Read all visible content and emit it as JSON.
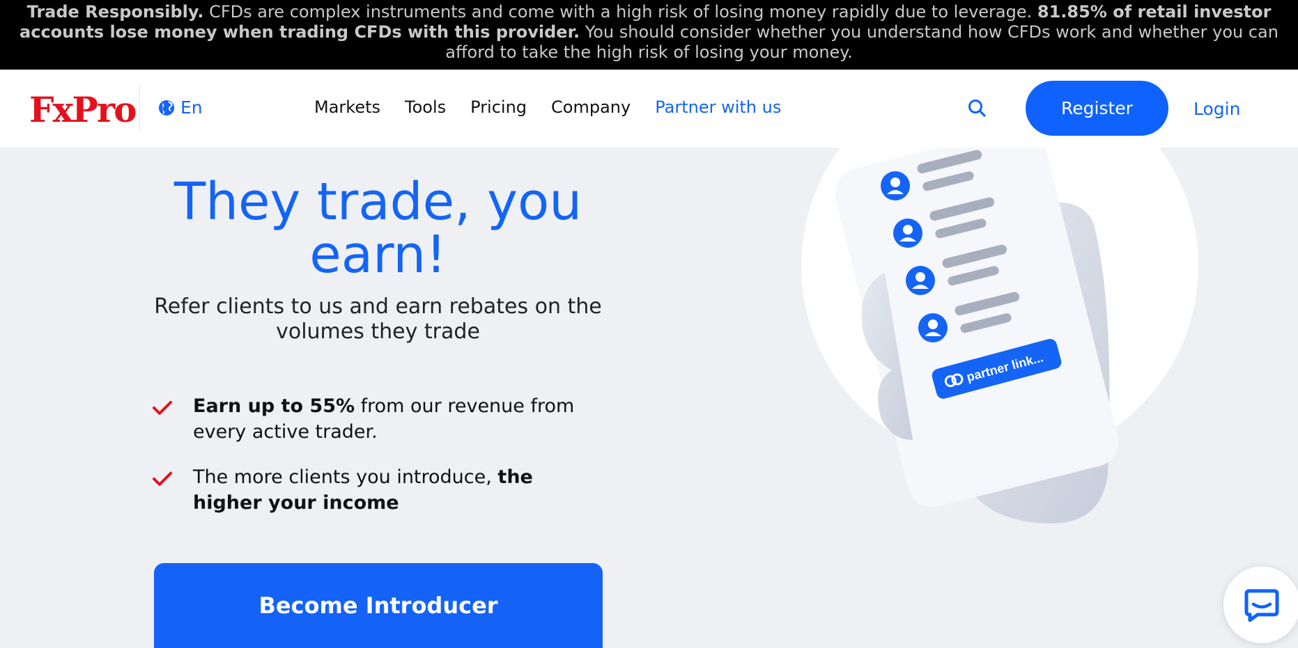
{
  "risk_warning": {
    "lead": "Trade Responsibly.",
    "text1": " CFDs are complex instruments and come with a high risk of losing money rapidly due to leverage. ",
    "stat": "81.85% of retail investor accounts lose money when trading CFDs with this provider.",
    "text2": " You should consider whether you understand how CFDs work and whether you can afford to take the high risk of losing your money."
  },
  "header": {
    "logo": "FxPro",
    "language": "En",
    "nav": [
      "Markets",
      "Tools",
      "Pricing",
      "Company",
      "Partner with us"
    ],
    "register_label": "Register",
    "login_label": "Login"
  },
  "hero": {
    "title": "They trade, you earn!",
    "subtitle": "Refer clients to us and earn rebates on the volumes they trade",
    "features": [
      {
        "bold": "Earn up to 55%",
        "text": " from our revenue from every active trader."
      },
      {
        "text": "The more clients you introduce, ",
        "bold": "the higher your income"
      }
    ],
    "cta_label": "Become Introducer"
  },
  "illustration": {
    "link_label": "partner link..."
  },
  "colors": {
    "brand_blue": "#0f62fe",
    "brand_red": "#e4111d",
    "check_red": "#e4111d"
  },
  "icons": [
    "globe-icon",
    "search-icon",
    "check-icon",
    "link-icon",
    "user-avatar-icon",
    "chat-icon"
  ]
}
